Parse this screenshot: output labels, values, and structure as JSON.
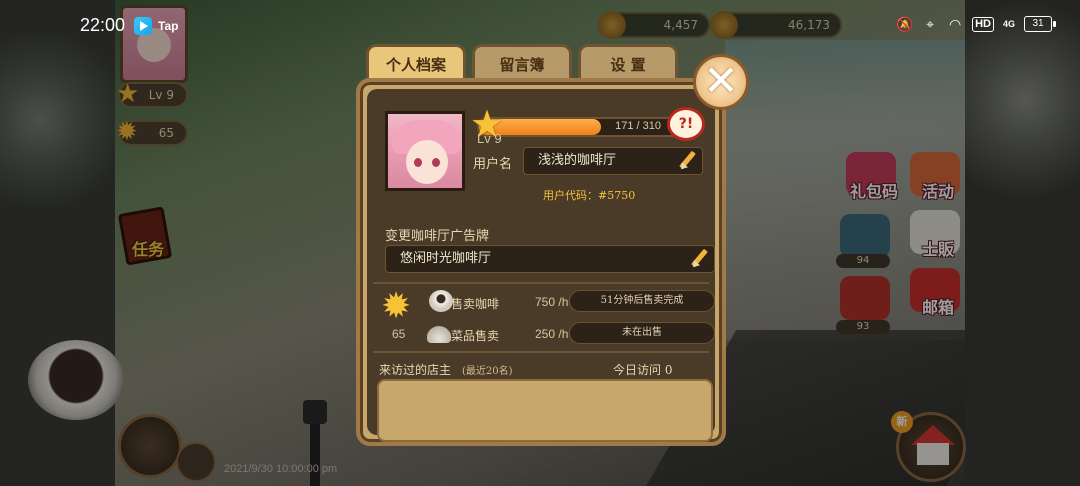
{
  "status_bar": {
    "time": "22:00",
    "app_label": "Tap",
    "hd_label": "HD",
    "network_label": "4G",
    "battery": "31"
  },
  "hud": {
    "currency_1": "4,457",
    "currency_2": "46,173",
    "level_small": "Lv 9",
    "stars_small": "65",
    "task_label": "任务",
    "timestamp": "2021/9/30 10:00:00 pm"
  },
  "right_menu": {
    "gift_code": "礼包码",
    "activity": "活动",
    "menu_count": "94",
    "store": "士販",
    "mail": "邮箱",
    "coffee_count": "93"
  },
  "tabs": [
    {
      "label": "个人档案"
    },
    {
      "label": "留言簿"
    },
    {
      "label": "设 置"
    }
  ],
  "profile": {
    "level": "Lv 9",
    "xp_text": "171 / 310",
    "xp_progress": 0.55,
    "username_label": "用户名",
    "username": "浅浅的咖啡厅",
    "user_code": "用户代码：#5750",
    "badge_text": "?!",
    "ad_label": "变更咖啡厅广告牌",
    "ad_text": "悠闲时光咖啡厅"
  },
  "stats": {
    "stars": "65",
    "coffee_label": "售卖咖啡",
    "coffee_rate": "750 /h",
    "coffee_status": "51分钟后售卖完成",
    "food_label": "菜品售卖",
    "food_rate": "250 /h",
    "food_status": "未在出售"
  },
  "visitors": {
    "title": "来访过的店主",
    "subtitle": "(最近20名)",
    "today": "今日访问 0"
  }
}
